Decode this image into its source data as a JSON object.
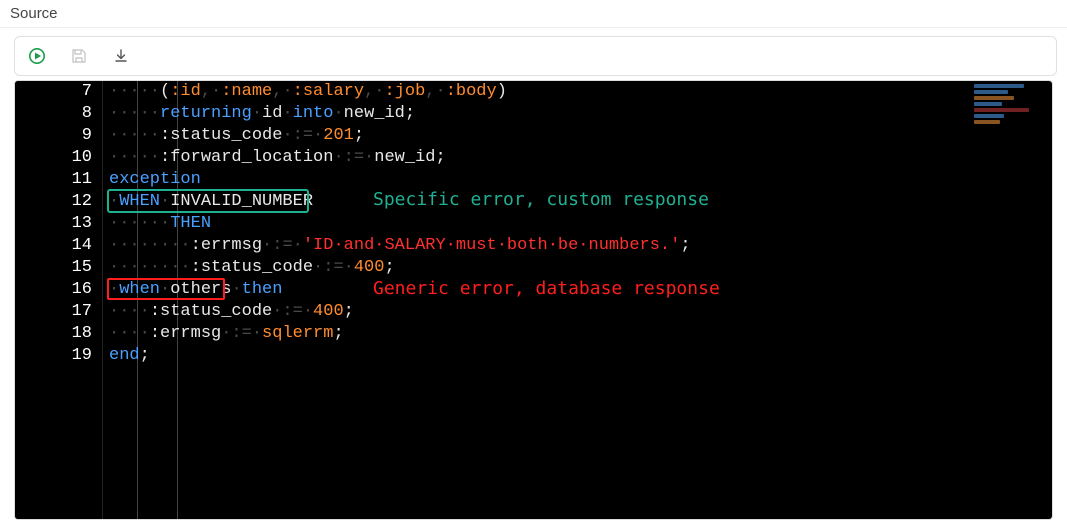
{
  "panel": {
    "title": "Source"
  },
  "toolbar": {
    "run_title": "Run",
    "save_title": "Save",
    "download_title": "Download"
  },
  "gutter": [
    "7",
    "8",
    "9",
    "10",
    "11",
    "12",
    "13",
    "14",
    "15",
    "16",
    "17",
    "18",
    "19"
  ],
  "code": {
    "r7": {
      "open": "(",
      "c1": ":id",
      "sep": ",·",
      "c2": ":name",
      "c3": ":salary",
      "c4": ":job",
      "c5": ":body",
      "close": ")"
    },
    "r8": {
      "kw1": "returning",
      "id1": "id",
      "kw2": "into",
      "id2": "new_id",
      "semi": ";"
    },
    "r9": {
      "lhs": ":status_code",
      "asg": "·:=·",
      "val": "201",
      "semi": ";"
    },
    "r10": {
      "lhs": ":forward_location",
      "asg": "·:=·",
      "val": "new_id",
      "semi": ";"
    },
    "r11": {
      "kw": "exception"
    },
    "r12": {
      "kw1": "WHEN",
      "sp": "·",
      "id": "INVALID_NUMBER"
    },
    "r13": {
      "kw": "THEN"
    },
    "r14": {
      "lhs": ":errmsg",
      "asg": "·:=·",
      "str": "'ID·and·SALARY·must·both·be·numbers.'",
      "semi": ";"
    },
    "r15": {
      "lhs": ":status_code",
      "asg": "·:=·",
      "val": "400",
      "semi": ";"
    },
    "r16": {
      "kw1": "when",
      "sp": "·",
      "id": "others",
      "sp2": "·",
      "kw2": "then"
    },
    "r17": {
      "lhs": ":status_code",
      "asg": "·:=·",
      "val": "400",
      "semi": ";"
    },
    "r18": {
      "lhs": ":errmsg",
      "asg": "·:=·",
      "val": "sqlerrm",
      "semi": ";"
    },
    "r19": {
      "kw": "end",
      "semi": ";"
    }
  },
  "annotations": {
    "specific": "Specific error, custom response",
    "generic": "Generic error, database response"
  }
}
